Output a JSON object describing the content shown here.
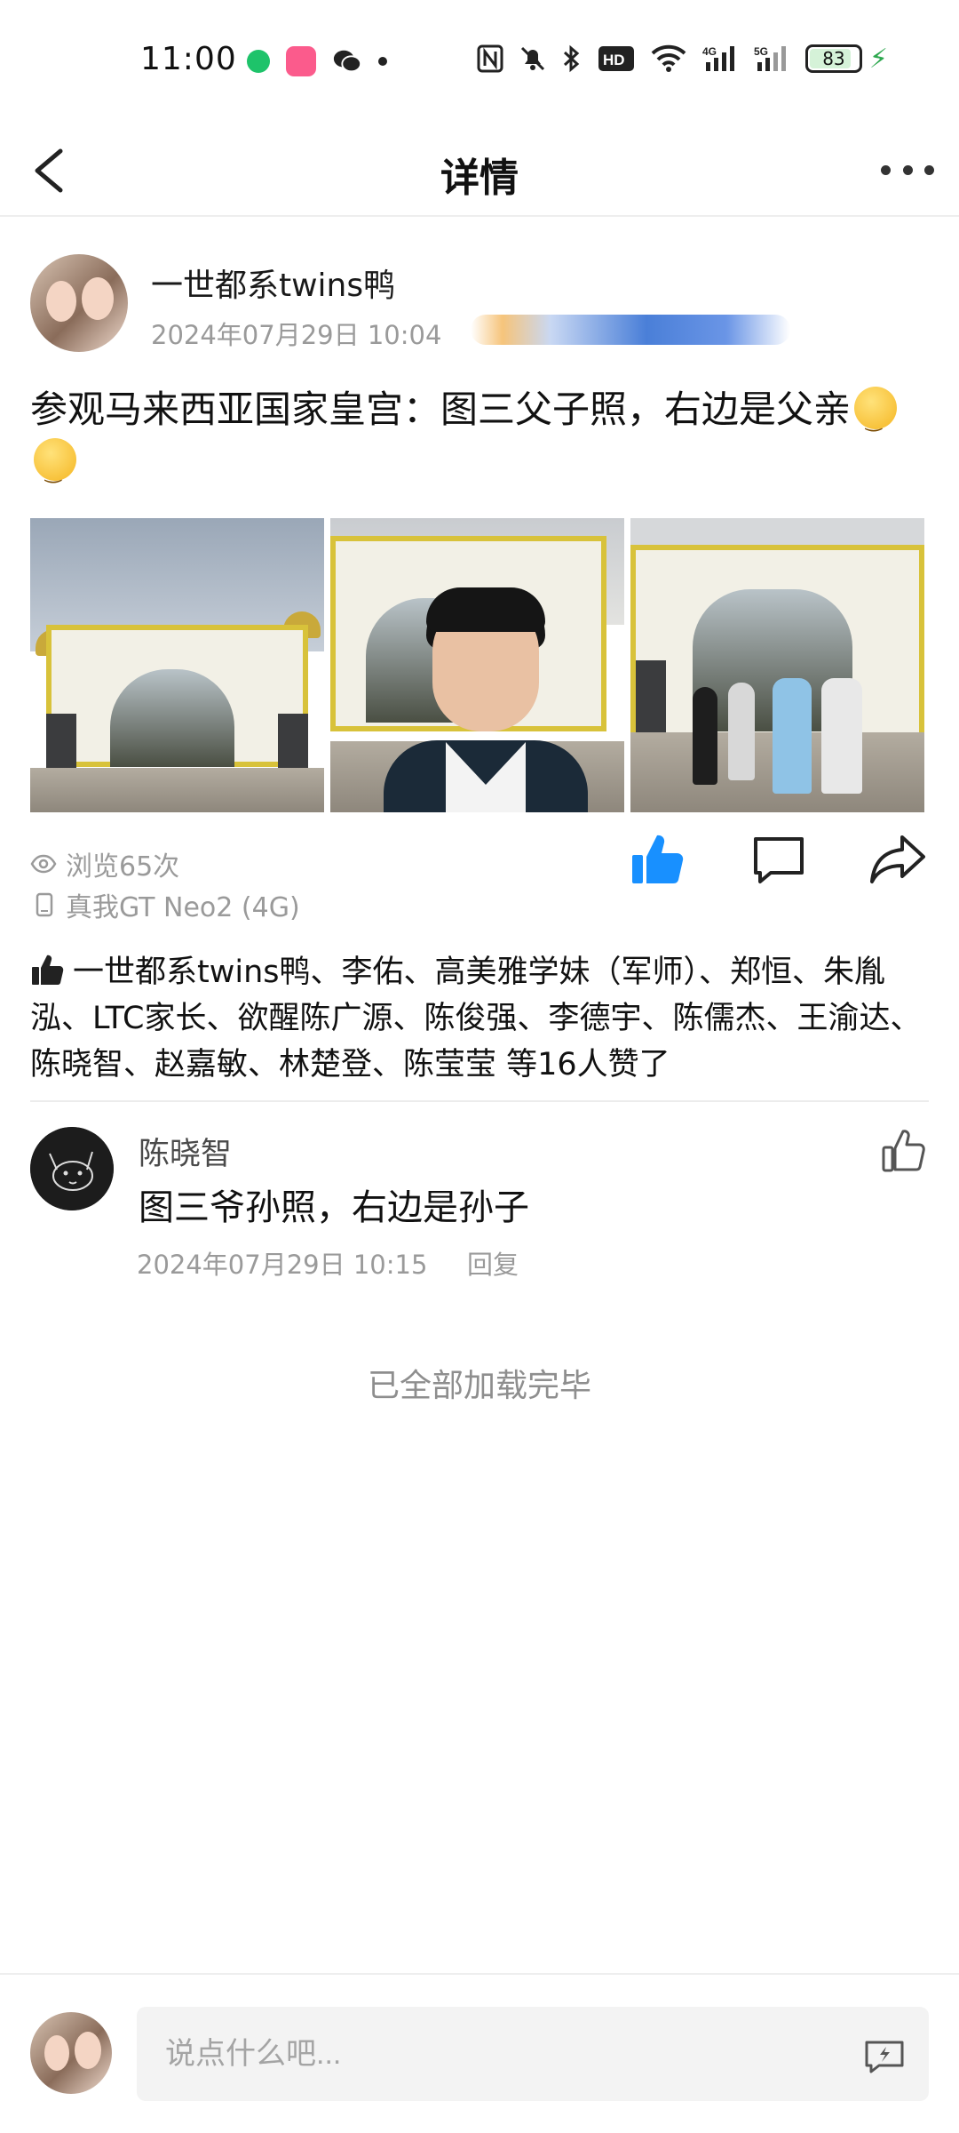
{
  "status_bar": {
    "time": "11:00",
    "network_4g": "4G",
    "network_5g": "5G",
    "hd_label": "HD",
    "battery": "83"
  },
  "nav": {
    "title": "详情"
  },
  "post": {
    "author": "一世都系twins鸭",
    "time": "2024年07月29日 10:04",
    "text": "参观马来西亚国家皇宫：图三父子照，右边是父亲",
    "views": "浏览65次",
    "device": "真我GT Neo2 (4G)"
  },
  "likes": {
    "text": "一世都系twins鸭、李佑、高美雅学妹（军师）、郑恒、朱胤泓、LTC家长、欲醒陈广源、陈俊强、李德宇、陈儒杰、王渝达、陈晓智、赵嘉敏、林楚登、陈莹莹 等16人赞了"
  },
  "comment": {
    "author": "陈晓智",
    "text": "图三爷孙照，右边是孙子",
    "time": "2024年07月29日 10:15",
    "reply_label": "回复"
  },
  "footer": {
    "all_loaded": "已全部加载完毕"
  },
  "input": {
    "placeholder": "说点什么吧..."
  },
  "colors": {
    "like_active": "#1890ff",
    "text_primary": "#111111",
    "text_secondary": "#9a9a9a"
  }
}
